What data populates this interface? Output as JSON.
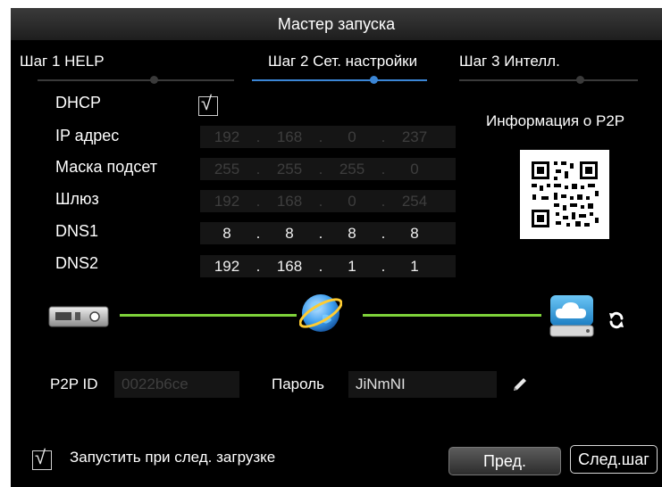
{
  "window": {
    "title": "Мастер запуска"
  },
  "steps": [
    {
      "label": "Шаг 1 HELP",
      "active": false
    },
    {
      "label": "Шаг 2 Сет. настройки",
      "active": true
    },
    {
      "label": "Шаг 3 Интелл.",
      "active": false
    }
  ],
  "dhcp": {
    "label": "DHCP",
    "checked": true
  },
  "network": [
    {
      "label": "IP адрес",
      "octets": [
        "192",
        "168",
        "0",
        "237"
      ],
      "enabled": false
    },
    {
      "label": "Маска подсет",
      "octets": [
        "255",
        "255",
        "255",
        "0"
      ],
      "enabled": false
    },
    {
      "label": "Шлюз",
      "octets": [
        "192",
        "168",
        "0",
        "254"
      ],
      "enabled": false
    },
    {
      "label": "DNS1",
      "octets": [
        "8",
        "8",
        "8",
        "8"
      ],
      "enabled": true
    },
    {
      "label": "DNS2",
      "octets": [
        "192",
        "168",
        "1",
        "1"
      ],
      "enabled": true
    }
  ],
  "p2p": {
    "info_label": "Информация о P2P",
    "qr_icon": "qr-code-icon",
    "id_label": "P2P ID",
    "id_value": "0022b6ce",
    "password_label": "Пароль",
    "password_value": "JiNmNI"
  },
  "topology": {
    "device_icon": "dvr-device-icon",
    "globe_icon": "internet-globe-icon",
    "cloud_icon": "cloud-server-icon",
    "refresh_icon": "refresh-icon",
    "link_color": "#7ed23a"
  },
  "autostart": {
    "label": "Запустить при след. загрузке",
    "checked": true
  },
  "buttons": {
    "prev": "Пред.",
    "next": "След.шаг"
  },
  "colors": {
    "accent": "#3b86d6",
    "background": "#000000",
    "link": "#7ed23a"
  }
}
